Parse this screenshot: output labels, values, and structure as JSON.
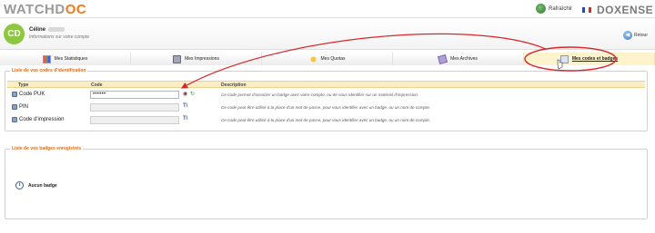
{
  "header": {
    "logo_main": "WATCHD",
    "logo_accent": "OC",
    "refresh_label": "Rafraîchir",
    "brand": "DOXENSE"
  },
  "user": {
    "initials": "CD",
    "first_name": "Céline",
    "subtitle": "Informations sur votre compte",
    "back_label": "Retour"
  },
  "tabs": [
    {
      "label": "Mes Statistiques",
      "icon": "chart-icon"
    },
    {
      "label": "Mes Impressions",
      "icon": "printer-icon"
    },
    {
      "label": "Mes Quotas",
      "icon": "coins-icon"
    },
    {
      "label": "Mes Archives",
      "icon": "archive-icon"
    },
    {
      "label": "Mes codes et badges",
      "icon": "badge-icon",
      "active": true
    }
  ],
  "ids_panel": {
    "title": "Liste de vos codes d'identification",
    "columns": {
      "type": "Type",
      "code": "Code",
      "description": "Description"
    },
    "rows": [
      {
        "type": "Code PUK",
        "code": "••••••",
        "description": "Ce code permet d'associer un badge avec votre compte, ou de vous identifier sur un matériel d'impression."
      },
      {
        "type": "PIN",
        "code": "",
        "description": "Ce code peut être utilisé à la place d'un mot de passe, pour vous identifier avec un badge, ou un nom de compte."
      },
      {
        "type": "Code d'impression",
        "code": "",
        "description": "Ce code peut être utilisé à la place d'un mot de passe, pour vous identifier avec un badge, ou un nom de compte."
      }
    ]
  },
  "badges_panel": {
    "title": "Liste de vos badges enregistrés",
    "empty_label": "Aucun badge"
  },
  "colors": {
    "accent_orange": "#f07a1a",
    "avatar_green": "#8dc63f",
    "highlight_yellow": "#fdf3cc",
    "annotation_red": "#d9262c"
  }
}
